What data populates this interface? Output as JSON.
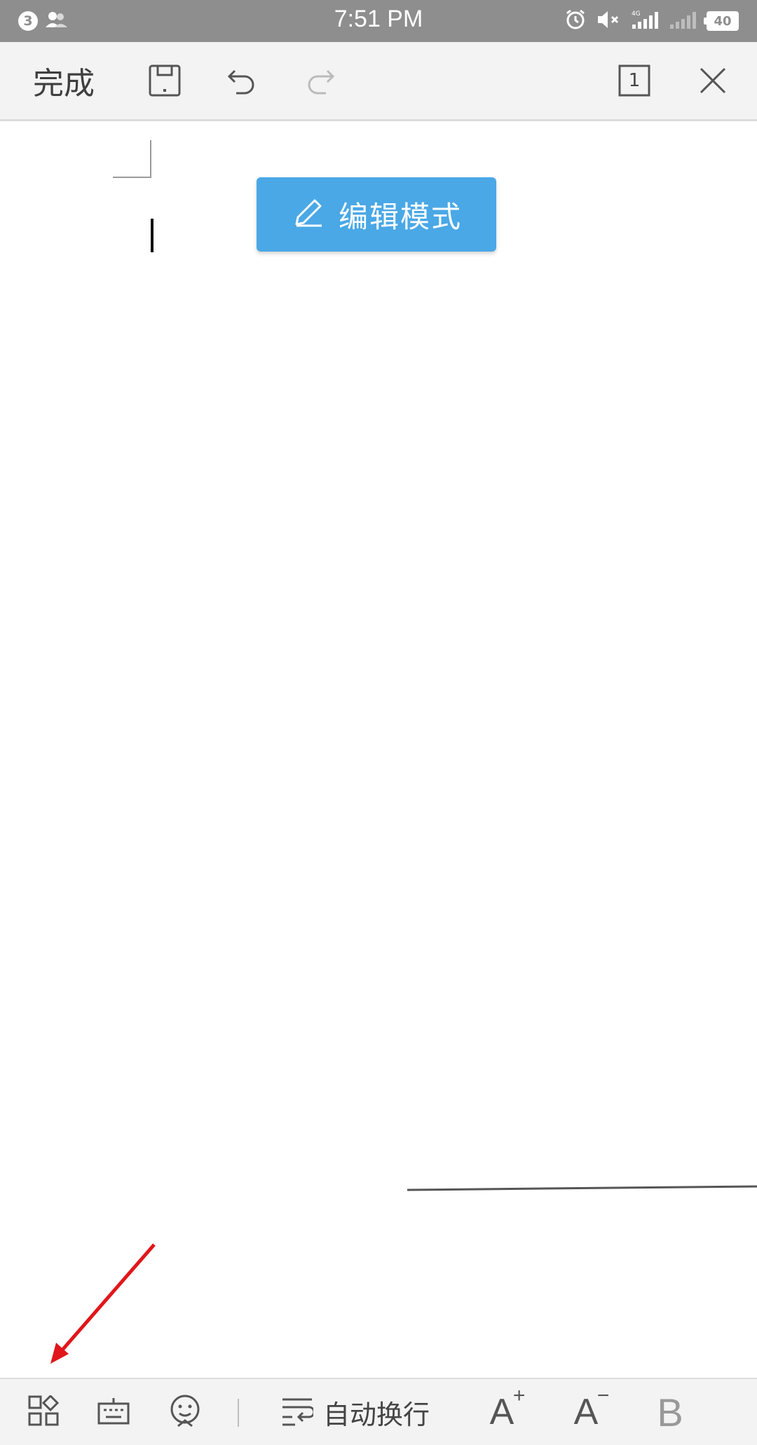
{
  "status_bar": {
    "notification_count": "3",
    "time": "7:51 PM",
    "network": "4G",
    "battery": "40"
  },
  "toolbar": {
    "done_label": "完成",
    "page_count": "1"
  },
  "document": {
    "edit_mode_label": "编辑模式"
  },
  "bottom_toolbar": {
    "wrap_label": "自动换行",
    "font_increase": "A",
    "font_decrease": "A",
    "bold": "B"
  },
  "icons": [
    "contacts-icon",
    "alarm-icon",
    "mute-icon",
    "signal-icon",
    "battery-icon",
    "save-icon",
    "undo-icon",
    "redo-icon",
    "page-icon",
    "close-icon",
    "pencil-icon",
    "apps-grid-icon",
    "keyboard-icon",
    "emoji-icon",
    "wrap-text-icon"
  ],
  "colors": {
    "status_bar": "#8e8e8e",
    "toolbar": "#f3f3f3",
    "accent": "#4aa8e6",
    "annotation_arrow": "#e0161b"
  }
}
